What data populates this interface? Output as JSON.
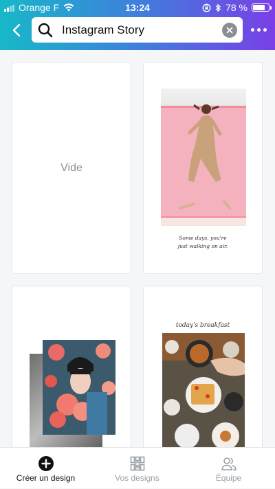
{
  "status_bar": {
    "carrier": "Orange F",
    "time": "13:24",
    "battery_text": "78 %",
    "battery_level": 0.78
  },
  "search": {
    "value": "Instagram Story",
    "icon": "search-icon"
  },
  "templates": [
    {
      "type": "empty",
      "label": "Vide"
    },
    {
      "type": "template",
      "caption_line1": "Some days, you're",
      "caption_line2": "just walking on air."
    },
    {
      "type": "template"
    },
    {
      "type": "template",
      "title": "today's breakfast"
    }
  ],
  "bottom_nav": [
    {
      "label": "Créer un design",
      "icon": "plus-circle-icon",
      "active": true
    },
    {
      "label": "Vos designs",
      "icon": "designs-grid-icon",
      "active": false
    },
    {
      "label": "Équipe",
      "icon": "team-icon",
      "active": false
    }
  ],
  "colors": {
    "header_gradient_start": "#17b8c8",
    "header_gradient_end": "#7a3fe6",
    "inactive_tab": "#9aa0a6"
  }
}
